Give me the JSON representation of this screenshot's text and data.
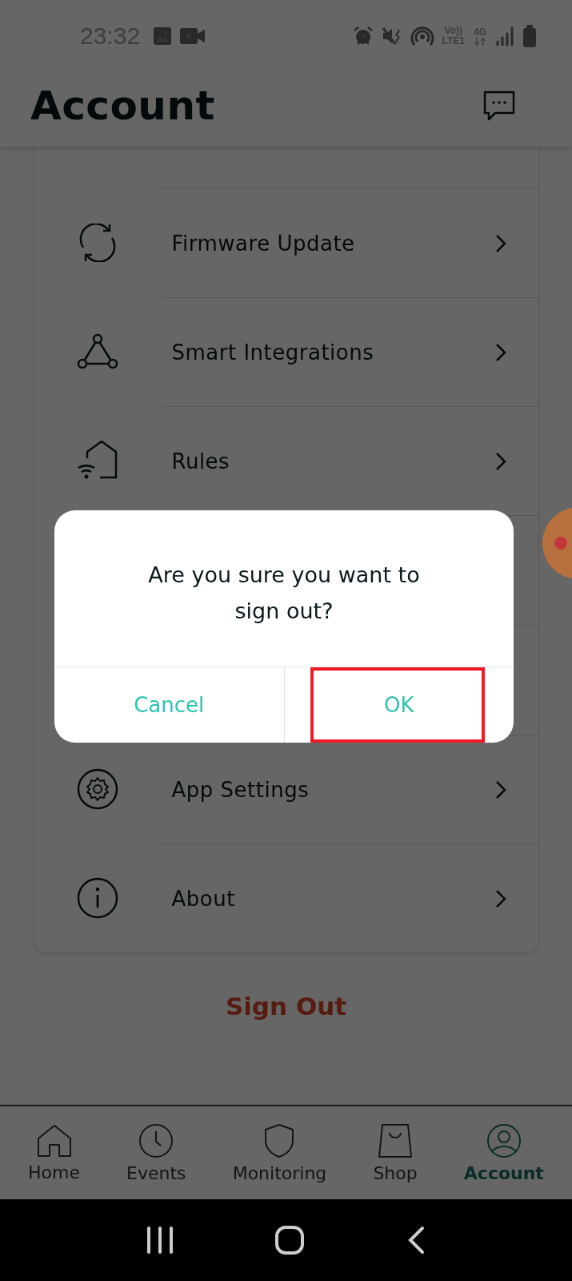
{
  "status_bar": {
    "time": "23:32",
    "volte": "Vo))",
    "lte": "LTE1",
    "network": "4G"
  },
  "header": {
    "title": "Account"
  },
  "menu": [
    {
      "label": "Firmware Update",
      "kind": "refresh"
    },
    {
      "label": "Smart Integrations",
      "kind": "network"
    },
    {
      "label": "Rules",
      "kind": "home-wifi"
    }
  ],
  "menu_lower": [
    {
      "label": "App Settings",
      "kind": "gear"
    },
    {
      "label": "About",
      "kind": "info"
    }
  ],
  "sign_out": "Sign Out",
  "dialog": {
    "message": "Are you sure you want to sign out?",
    "buttons": [
      {
        "label": "Cancel",
        "highlighted": false
      },
      {
        "label": "OK",
        "highlighted": true
      }
    ]
  },
  "bottom_nav": [
    {
      "label": "Home",
      "kind": "home",
      "selected": false
    },
    {
      "label": "Events",
      "kind": "clock",
      "selected": false
    },
    {
      "label": "Monitoring",
      "kind": "shield",
      "selected": false
    },
    {
      "label": "Shop",
      "kind": "bag",
      "selected": false
    },
    {
      "label": "Account",
      "kind": "person",
      "selected": true
    }
  ]
}
